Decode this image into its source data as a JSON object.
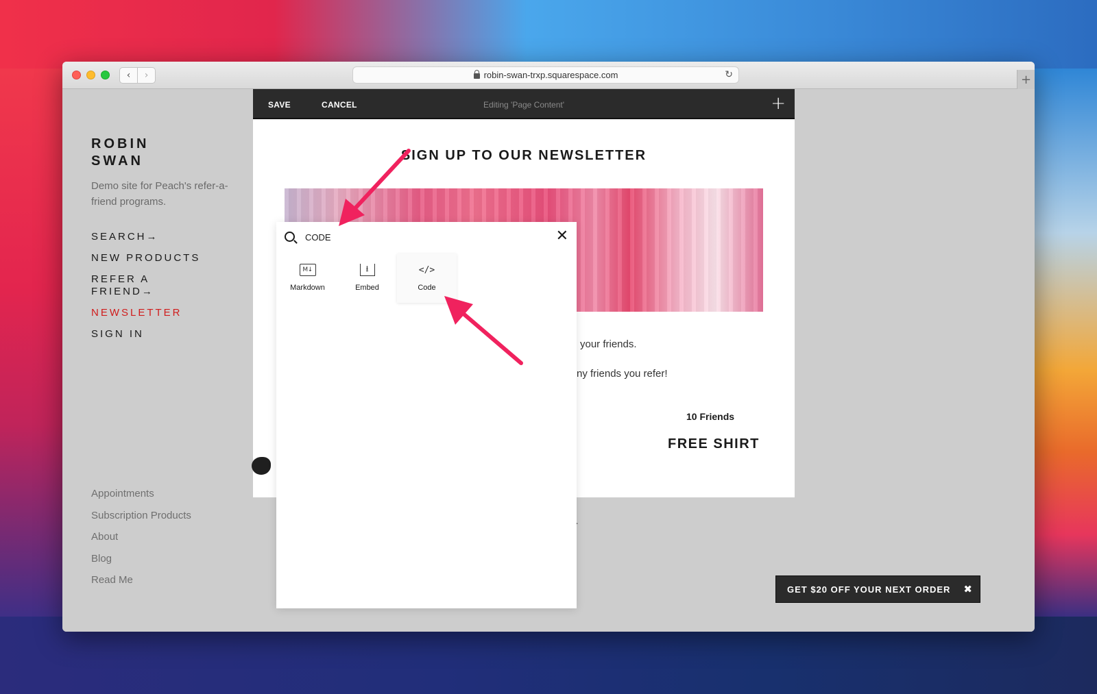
{
  "colors": {
    "accent_nav_active": "#d01c1c",
    "toolbar_bg": "#2b2b2b",
    "annotation_arrow": "#f0225e"
  },
  "browser": {
    "url": "robin-swan-trxp.squarespace.com",
    "back_icon": "chevron-left-icon",
    "forward_icon": "chevron-right-icon",
    "reload_icon": "reload-icon",
    "new_tab_icon": "plus-icon"
  },
  "sidebar": {
    "site_title": "ROBIN SWAN",
    "site_description": "Demo site for Peach's refer-a-friend programs.",
    "nav_items": [
      {
        "label": "SEARCH→",
        "active": false
      },
      {
        "label": "NEW PRODUCTS",
        "active": false
      },
      {
        "label": "REFER A FRIEND→",
        "active": false
      },
      {
        "label": "NEWSLETTER",
        "active": true
      },
      {
        "label": "SIGN IN",
        "active": false
      }
    ],
    "footer_links": [
      "Appointments",
      "Subscription Products",
      "About",
      "Blog",
      "Read Me"
    ]
  },
  "toolbar": {
    "save_label": "SAVE",
    "cancel_label": "CANCEL",
    "status_text": "Editing 'Page Content'",
    "add_icon": "plus-icon"
  },
  "page": {
    "heading": "SIGN UP TO OUR NEWSLETTER",
    "text_line_1": "your friends.",
    "text_line_2": "ny friends you refer!",
    "friends_label": "10 Friends",
    "reward_label": "FREE SHIRT",
    "below_text": "e."
  },
  "block_picker": {
    "search_value": "CODE",
    "blocks": [
      {
        "label": "Markdown",
        "icon": "markdown-icon",
        "icon_glyph": "M↓"
      },
      {
        "label": "Embed",
        "icon": "embed-icon",
        "icon_glyph": "⭳"
      },
      {
        "label": "Code",
        "icon": "code-icon",
        "icon_glyph": "</>"
      }
    ]
  },
  "promo": {
    "label": "GET $20 OFF YOUR NEXT ORDER",
    "close_icon": "close-icon"
  }
}
